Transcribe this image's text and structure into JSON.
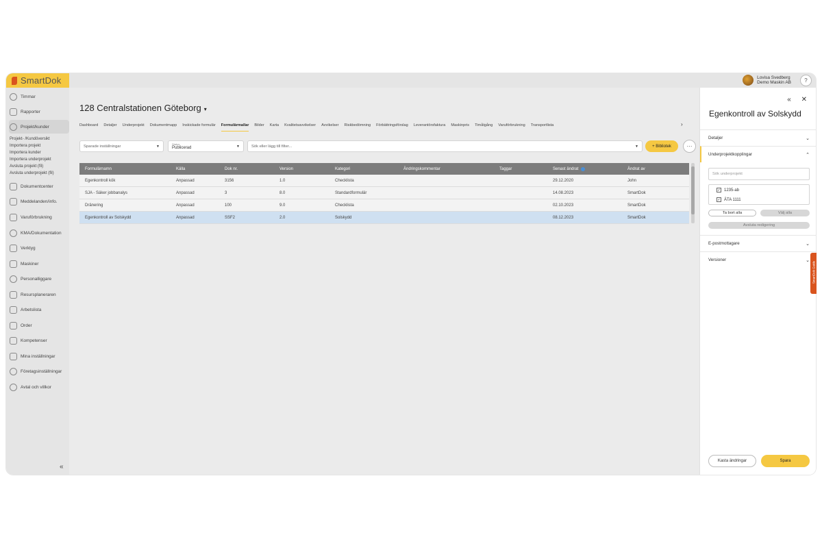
{
  "brand": {
    "logo_text": "SmartDok"
  },
  "user": {
    "name": "Lovisa Svedberg",
    "company": "Demo Maskin AB",
    "help_label": "?"
  },
  "sidebar": {
    "items": [
      {
        "label": "Timmar",
        "icon": "clock-icon"
      },
      {
        "label": "Rapporter",
        "icon": "report-icon"
      },
      {
        "label": "Projekt/kunder",
        "icon": "globe-icon"
      },
      {
        "label": "Dokumentcenter",
        "icon": "folder-icon"
      },
      {
        "label": "Meddelanden/info.",
        "icon": "message-icon"
      },
      {
        "label": "Varuförbrukning",
        "icon": "truck-icon"
      },
      {
        "label": "KMA/Dokumentation",
        "icon": "shield-icon"
      },
      {
        "label": "Verktyg",
        "icon": "tools-icon"
      },
      {
        "label": "Maskiner",
        "icon": "machine-icon"
      },
      {
        "label": "Personalliggare",
        "icon": "people-icon"
      },
      {
        "label": "Resursplaneraren",
        "icon": "planner-icon"
      },
      {
        "label": "Arbetslista",
        "icon": "list-icon"
      },
      {
        "label": "Order",
        "icon": "order-icon"
      },
      {
        "label": "Kompetenser",
        "icon": "competence-icon"
      },
      {
        "label": "Mina inställningar",
        "icon": "sliders-icon"
      },
      {
        "label": "Företagsinställningar",
        "icon": "gear-icon"
      },
      {
        "label": "Avtal och villkor",
        "icon": "handshake-icon"
      }
    ],
    "sub_items": [
      "Projekt- /Kundöversikt",
      "Importera projekt",
      "Importera kunder",
      "Importera underprojekt",
      "Avsluta projekt (fil)",
      "Avsluta underprojekt (fil)"
    ],
    "collapse_label": "«"
  },
  "project": {
    "title": "128 Centralstationen Göteborg",
    "caret": "▾",
    "tabs": [
      "Dashboard",
      "Detaljer",
      "Underprojekt",
      "Dokumentmapp",
      "Inskickade formulär",
      "Formulärmallar",
      "Bilder",
      "Karta",
      "Kvalitetsavvikelser",
      "Avvikelser",
      "Riskbedömning",
      "Förbättringsförslag",
      "Leverantörsfaktura",
      "Maskinpris",
      "Timåtgång",
      "Varuförbrukning",
      "Transportlista"
    ],
    "active_tab": "Formulärmallar",
    "tab_next": "›"
  },
  "filters": {
    "saved_settings": "Sparade inställningar",
    "status_label": "Status",
    "status_value": "Publicerad",
    "search_placeholder": "Sök eller lägg till filter...",
    "library_button": "+ Bibliotek",
    "more_button": "···"
  },
  "table": {
    "columns": [
      "Formulärnamn",
      "Källa",
      "Dok nr.",
      "Version",
      "Kategori",
      "Ändringskommentar",
      "Taggar",
      "Senast ändrat",
      "Ändrat av"
    ],
    "rows": [
      [
        "Egenkontroll kök",
        "Anpassad",
        "3156",
        "1.0",
        "Checklista",
        "",
        "",
        "29.12.2020",
        "John"
      ],
      [
        "SJA - Säker jobbanalys",
        "Anpassad",
        "3",
        "8.0",
        "Standardformulär",
        "",
        "",
        "14.08.2023",
        "SmartDok"
      ],
      [
        "Dränering",
        "Anpassad",
        "100",
        "9.0",
        "Checklista",
        "",
        "",
        "02.10.2023",
        "SmartDok"
      ],
      [
        "Egenkontroll av Solskydd",
        "Anpassad",
        "SSF2",
        "2.0",
        "Solskydd",
        "",
        "",
        "08.12.2023",
        "SmartDok"
      ]
    ],
    "selected_row": 3
  },
  "panel": {
    "controls": "« ✕",
    "title": "Egenkontroll av Solskydd",
    "sections": {
      "detaljer": "Detaljer",
      "underprojekt": "Underprojektkopplingar",
      "epost": "E-postmottagare",
      "versioner": "Versioner"
    },
    "sub_search_placeholder": "Sök underprojekt",
    "sub_projects": [
      {
        "label": "1235-ab",
        "checked": true
      },
      {
        "label": "ÄTA 1111",
        "checked": true
      }
    ],
    "remove_all": "Ta bort alla",
    "select_all": "Välj alla",
    "finish_editing": "Avsluta redigering",
    "discard": "Kasta ändringar",
    "save": "Spara"
  },
  "guide_tab": "SmartDok Guide",
  "colors": {
    "accent": "#f5c842",
    "brand_orange": "#d9541e",
    "selected_row": "#cfe0f1",
    "table_header": "#7c7c7c"
  }
}
